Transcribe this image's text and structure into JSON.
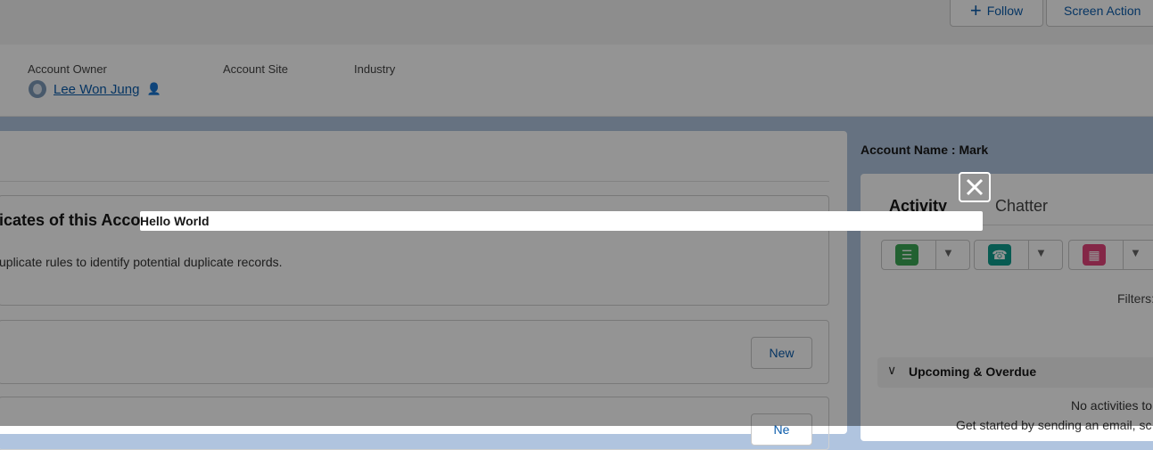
{
  "header": {
    "follow_label": "Follow",
    "follow_icon": "plus-icon",
    "screen_action_label": "Screen Action"
  },
  "highlights": {
    "owner_label": "Account Owner",
    "owner_name": "Lee Won Jung",
    "site_label": "Account Site",
    "industry_label": "Industry"
  },
  "main": {
    "duplicates_title": "icates of this Accou",
    "duplicates_text": "uplicate rules to identify potential duplicate records.",
    "new_label": "New",
    "new_label_2": "Ne"
  },
  "sidebar": {
    "account_name": "Account Name : Mark",
    "tabs": [
      {
        "label": "Activity"
      },
      {
        "label": "Chatter"
      }
    ],
    "activity_buttons": [
      {
        "icon": "task-icon",
        "color": "#3ba755"
      },
      {
        "icon": "log-call-icon",
        "color": "#0f9d8e"
      },
      {
        "icon": "event-icon",
        "color": "#e3447b"
      }
    ],
    "filters_label": "Filters:",
    "upcoming_label": "Upcoming & Overdue",
    "no_activities_text": "No activities to",
    "get_started_text": "Get started by sending an email, sc"
  },
  "modal": {
    "text": "Hello World",
    "close_icon": "close-icon"
  }
}
